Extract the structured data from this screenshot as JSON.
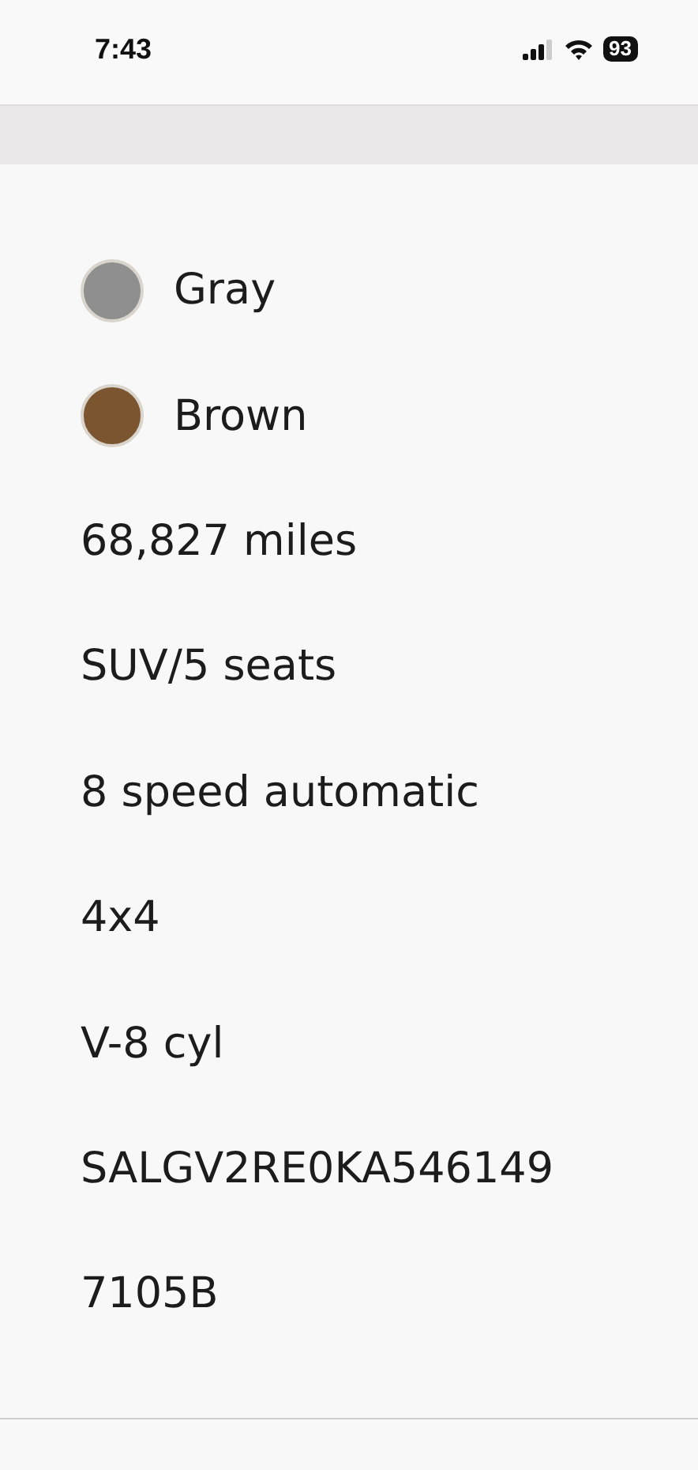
{
  "status_bar": {
    "time": "7:43",
    "battery": "93"
  },
  "details": [
    {
      "kind": "color",
      "label": "Gray",
      "color": "#8f8f90"
    },
    {
      "kind": "color",
      "label": "Brown",
      "color": "#7a5530"
    },
    {
      "kind": "text",
      "label": "68,827 miles"
    },
    {
      "kind": "text",
      "label": "SUV/5 seats"
    },
    {
      "kind": "text",
      "label": "8 speed automatic"
    },
    {
      "kind": "text",
      "label": "4x4"
    },
    {
      "kind": "text",
      "label": "V-8 cyl"
    },
    {
      "kind": "text",
      "label": "SALGV2RE0KA546149"
    },
    {
      "kind": "text",
      "label": "7105B"
    }
  ]
}
